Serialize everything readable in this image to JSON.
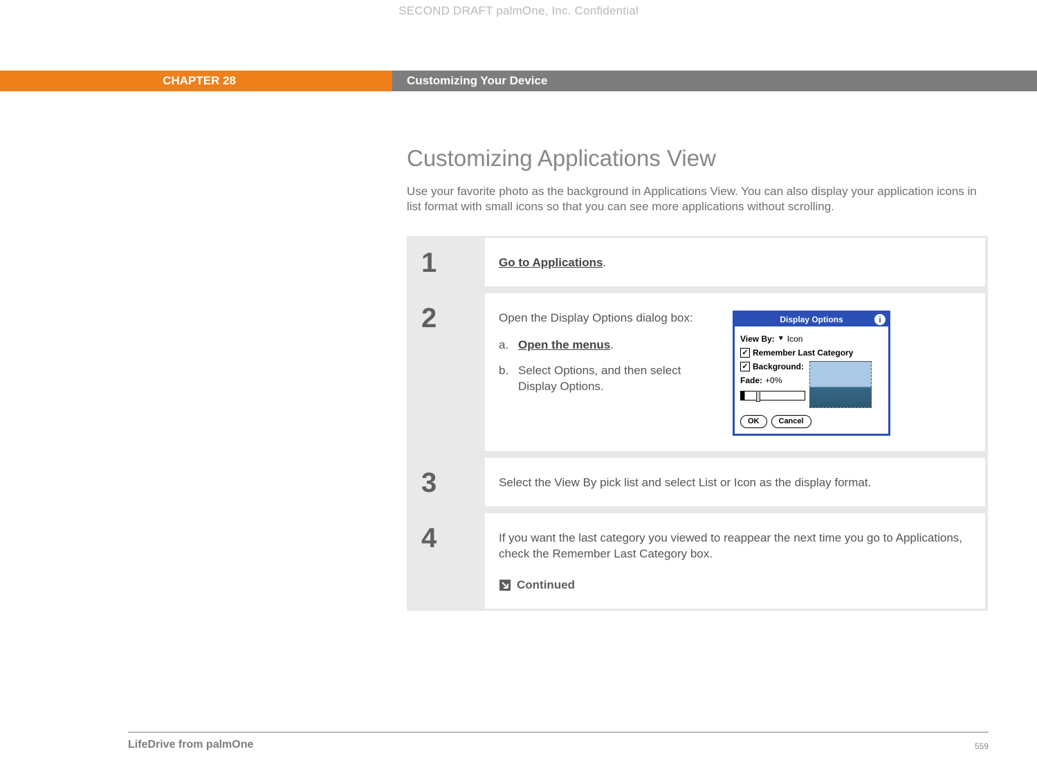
{
  "watermark": "SECOND DRAFT palmOne, Inc.  Confidential",
  "banner": {
    "chapter": "CHAPTER 28",
    "title": "Customizing Your Device"
  },
  "section": {
    "title": "Customizing Applications View",
    "intro": "Use your favorite photo as the background in Applications View. You can also display your application icons in list format with small icons so that you can see more applications without scrolling."
  },
  "steps": [
    {
      "num": "1",
      "link_text": "Go to Applications",
      "trailing": "."
    },
    {
      "num": "2",
      "lead": "Open the Display Options dialog box:",
      "subs": [
        {
          "letter": "a.",
          "bold_link": "Open the menus",
          "trail": "."
        },
        {
          "letter": "b.",
          "plain": "Select Options, and then select Display Options."
        }
      ]
    },
    {
      "num": "3",
      "plain": "Select the View By pick list and select List or Icon as the display format."
    },
    {
      "num": "4",
      "plain": "If you want the last category you viewed to reappear the next time you go to Applications, check the Remember Last Category box.",
      "continued": "Continued"
    }
  ],
  "dialog": {
    "title": "Display Options",
    "info_glyph": "i",
    "view_by_label": "View By:",
    "view_by_value": "Icon",
    "remember_label": "Remember Last Category",
    "background_label": "Background:",
    "fade_label": "Fade:",
    "fade_value": "+0%",
    "ok": "OK",
    "cancel": "Cancel",
    "check_glyph": "✓"
  },
  "footer": {
    "product": "LifeDrive from palmOne",
    "page": "559"
  }
}
